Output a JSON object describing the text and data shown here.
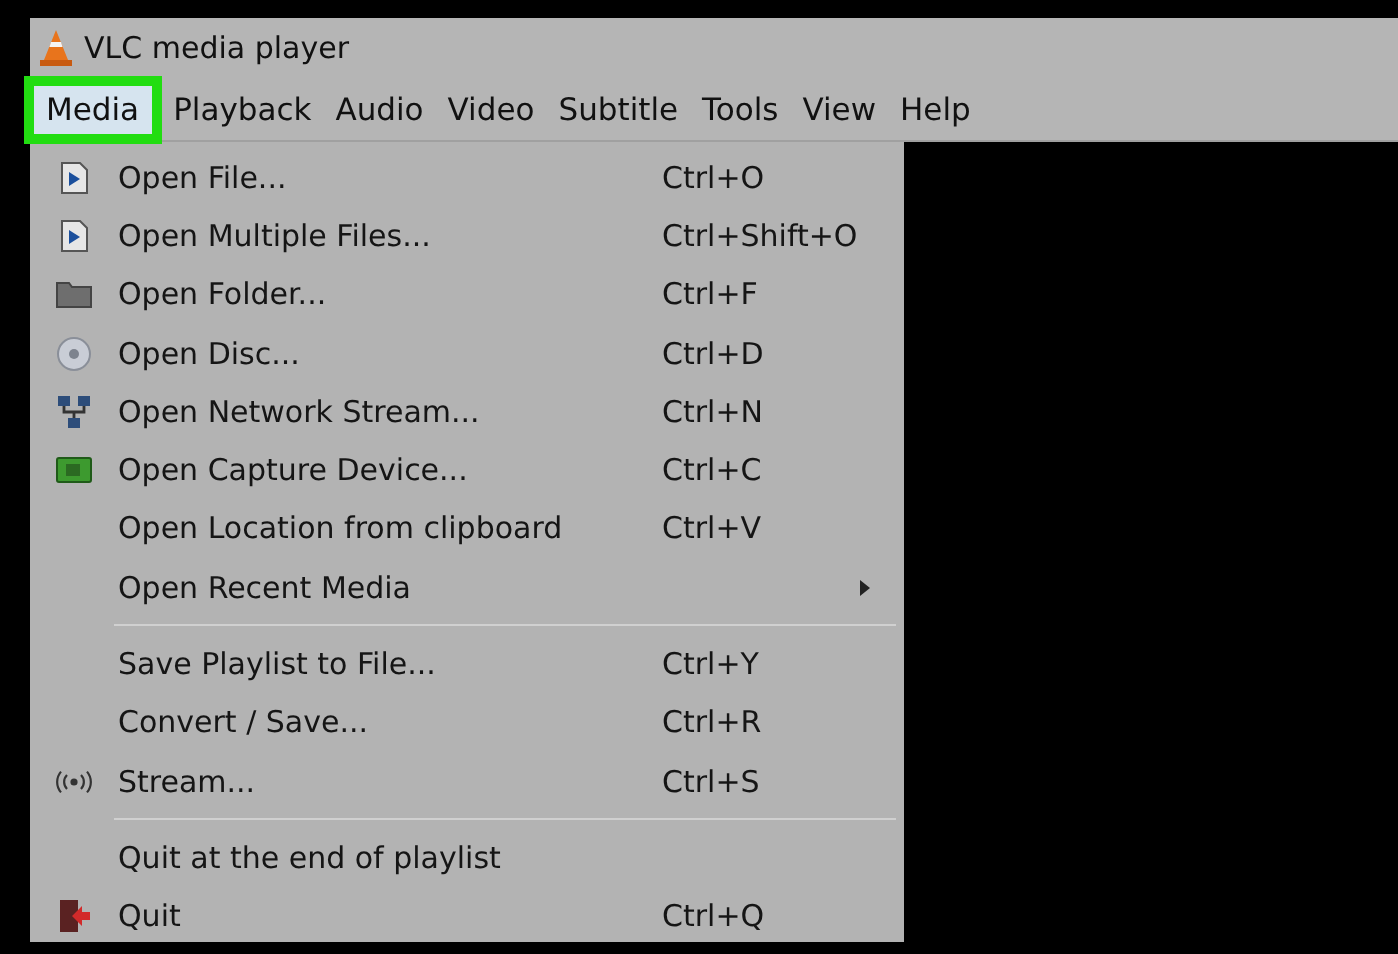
{
  "window": {
    "title": "VLC media player"
  },
  "menu_bar": [
    {
      "label": "Media",
      "selected": true
    },
    {
      "label": "Playback",
      "selected": false
    },
    {
      "label": "Audio",
      "selected": false
    },
    {
      "label": "Video",
      "selected": false
    },
    {
      "label": "Subtitle",
      "selected": false
    },
    {
      "label": "Tools",
      "selected": false
    },
    {
      "label": "View",
      "selected": false
    },
    {
      "label": "Help",
      "selected": false
    }
  ],
  "menu_groups": [
    [
      {
        "label": "Open File...",
        "shortcut": "Ctrl+O",
        "submenu": false
      },
      {
        "label": "Open Multiple Files...",
        "shortcut": "Ctrl+Shift+O",
        "submenu": false
      },
      {
        "label": "Open Folder...",
        "shortcut": "Ctrl+F",
        "submenu": false
      },
      {
        "label": "Open Disc...",
        "shortcut": "Ctrl+D",
        "submenu": false
      },
      {
        "label": "Open Network Stream...",
        "shortcut": "Ctrl+N",
        "submenu": false
      },
      {
        "label": "Open Capture Device...",
        "shortcut": "Ctrl+C",
        "submenu": false
      },
      {
        "label": "Open Location from clipboard",
        "shortcut": "Ctrl+V",
        "submenu": false
      },
      {
        "label": "Open Recent Media",
        "submenu": true
      }
    ],
    [
      {
        "label": "Save Playlist to File...",
        "shortcut": "Ctrl+Y",
        "submenu": false
      },
      {
        "label": "Convert / Save...",
        "shortcut": "Ctrl+R",
        "submenu": false
      },
      {
        "label": "Stream...",
        "shortcut": "Ctrl+S",
        "submenu": false
      }
    ],
    [
      {
        "label": "Quit at the end of playlist",
        "submenu": false
      },
      {
        "label": "Quit",
        "shortcut": "Ctrl+Q",
        "submenu": false
      }
    ]
  ]
}
